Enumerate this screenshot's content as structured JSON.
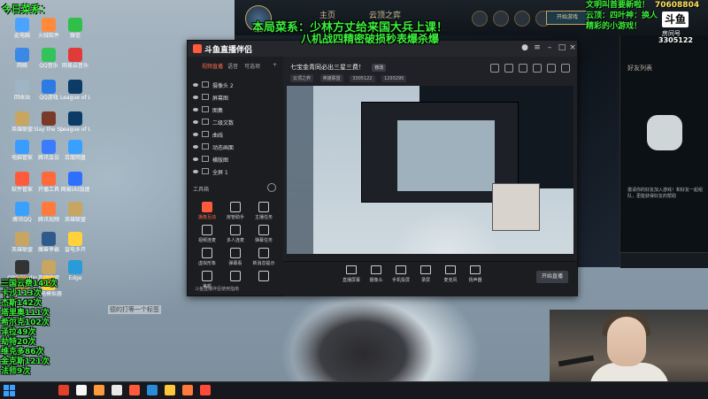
{
  "overlays": {
    "top_left": "今日菜系：",
    "headline_1": "本局菜系：少林方丈给来国大兵上课！",
    "headline_2": "八机战四精密破损秒表爆杀爆",
    "top_right_lines": [
      "文明叫首要新啦！",
      "云顶：四叶神：换人",
      "精彩的小游戏！"
    ],
    "top_right_number": "70608804",
    "fan_badge": "斗鱼",
    "fan_label": "房间号",
    "fan_count": "3305122",
    "stats_list": [
      "三国云费141次",
      "卡沙113次",
      "杰斯142次",
      "塔里奥111次",
      "希尔克102次",
      "泽拉49次",
      "劫特20次",
      "维克多86次",
      "金克斯121次",
      "法师9次"
    ],
    "sub_caption": "德的打等一个标签"
  },
  "game": {
    "tabs": [
      "主页",
      "云顶之弈"
    ],
    "play_button": "开始游戏",
    "friends_title": "好友列表",
    "side_note": "邀请你的好友加入游戏！和好友一起组队，更能获得好友的帮助"
  },
  "streamer": {
    "app_title": "斗鱼直播伴侣",
    "tabs": [
      "视频直播",
      "语音",
      "可选项"
    ],
    "scenes": [
      "摄像头 2",
      "屏幕图",
      "图集",
      "二级文数",
      "曲线",
      "动态画面",
      "横版图",
      "全屏 1"
    ],
    "tools_section": "工具箱",
    "tools": [
      "摄像互动",
      "房管助手",
      "主播任务",
      "视频连麦",
      "多人连麦",
      "弹幕任务",
      "虚拟形象",
      "弹幕看",
      "新消息提示",
      "美颜",
      "",
      ""
    ],
    "footer_note": "斗鱼直播伴侣使用指南",
    "room_title": "七宝金青同必出三星三费！",
    "room_tag": "修改",
    "meta": [
      "云顶之弈",
      "英雄联盟",
      "3305122",
      "1293295"
    ],
    "controls": [
      "直播屏幕",
      "摄像头",
      "手机投屏",
      "录屏",
      "麦克风",
      "扬声器"
    ],
    "start_button": "开始直播"
  },
  "desktop_icons": [
    {
      "label": "此电脑",
      "color": "#4aa3ff"
    },
    {
      "label": "网络",
      "color": "#3c88e6"
    },
    {
      "label": "回收站",
      "color": "#9fb4c4"
    },
    {
      "label": "英雄联盟",
      "color": "#c8a560"
    },
    {
      "label": "电脑管家",
      "color": "#3a9cff"
    },
    {
      "label": "软件管家",
      "color": "#ff5a3c"
    },
    {
      "label": "腾讯QQ",
      "color": "#3aa0ff"
    },
    {
      "label": "英雄联盟",
      "color": "#c8a560"
    },
    {
      "label": "OBS Studio",
      "color": "#333333"
    },
    {
      "label": "英雄联盟 WeGame",
      "color": "#c8a560"
    },
    {
      "label": "火绒软件",
      "color": "#ff8a3c"
    },
    {
      "label": "QQ音乐",
      "color": "#32c35a"
    },
    {
      "label": "QQ游戏",
      "color": "#2c7be5"
    },
    {
      "label": "Slay the Spire",
      "color": "#7a3a2a"
    },
    {
      "label": "腾讯会议",
      "color": "#3a7bff"
    },
    {
      "label": "开播工具",
      "color": "#ff6a3c"
    },
    {
      "label": "腾讯视频",
      "color": "#ff7a3c"
    },
    {
      "label": "魔兽争霸",
      "color": "#2f5a8a"
    },
    {
      "label": "英雄联盟",
      "color": "#c8a560"
    },
    {
      "label": "雷电模拟器",
      "color": "#ffd23c"
    },
    {
      "label": "微信",
      "color": "#2fbf4a"
    },
    {
      "label": "网易云音乐",
      "color": "#e13a3a"
    },
    {
      "label": "League of Legends",
      "color": "#0b3b66"
    },
    {
      "label": "League of Legends",
      "color": "#0b3b66"
    },
    {
      "label": "百度网盘",
      "color": "#3aa0ff"
    },
    {
      "label": "网易UU加速",
      "color": "#2f6fff"
    },
    {
      "label": "英雄联盟",
      "color": "#c8a560"
    },
    {
      "label": "雷电多开",
      "color": "#ffd23c"
    },
    {
      "label": "Edge",
      "color": "#2a9bd8"
    }
  ],
  "taskbar": {
    "items": [
      "#e1402a",
      "#f7f7f7",
      "#ff9a3c",
      "#e8e8e8",
      "#ff5a3c",
      "#2a8bd8",
      "#ffc83c",
      "#ff7a3c",
      "#ff4a3a"
    ]
  }
}
